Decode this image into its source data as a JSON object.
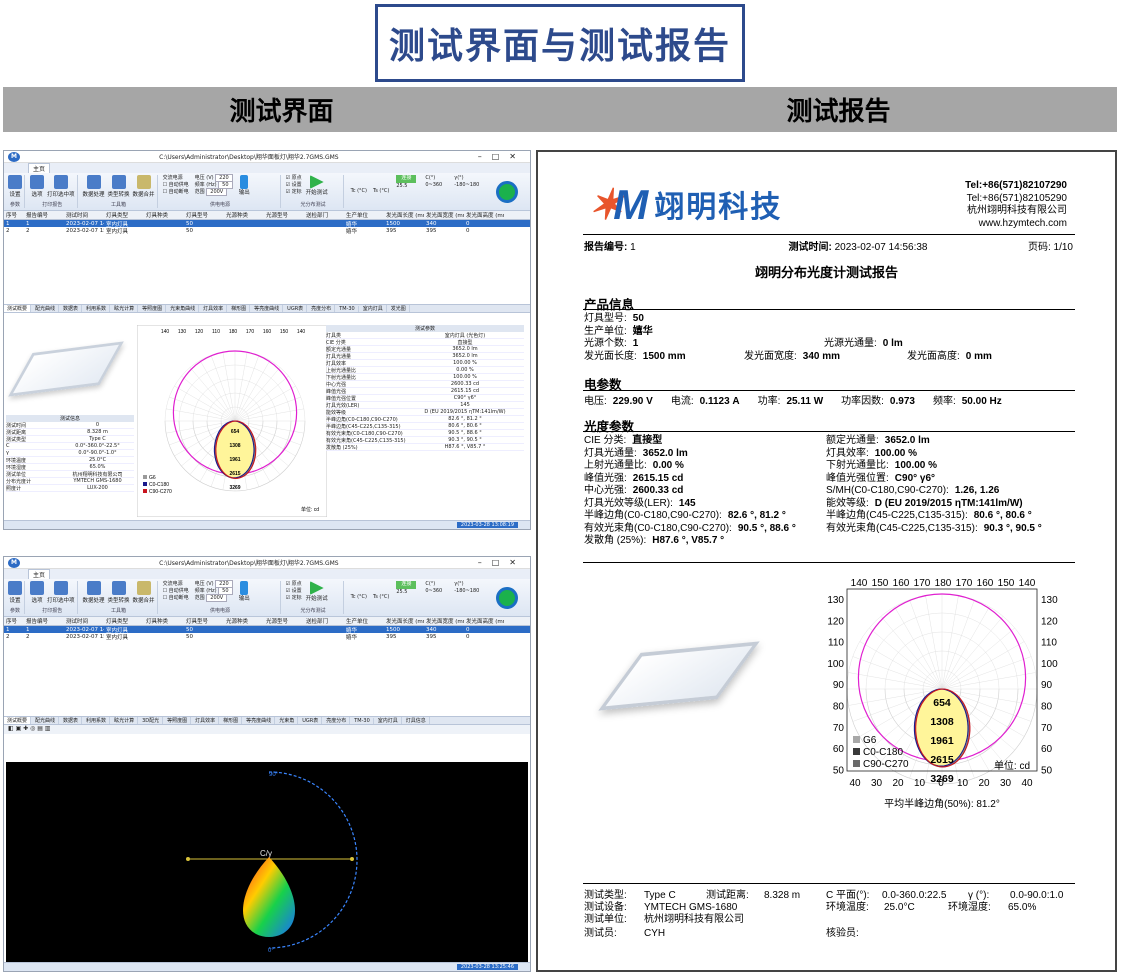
{
  "page": {
    "title": "测试界面与测试报告",
    "left_header": "测试界面",
    "right_header": "测试报告"
  },
  "software": {
    "window_path": "C:\\Users\\Administrator\\Desktop\\翔华面板灯\\翔华2.7GMS.GMS",
    "window_path_2": "C:\\Users\\Administrator\\Desktop\\翔华面板灯\\翔华2.7GMS.GMS",
    "menu_tab": "主页",
    "ribbon_groups": [
      "参数",
      "打印报告",
      "工具箱",
      "供电电源",
      "光分布测试"
    ],
    "ribbon_buttons": [
      "设置",
      "选项",
      "打印选中项",
      "数据处理",
      "类型转换",
      "数据合并"
    ],
    "power_options": [
      "交流电源",
      "自动供电",
      "自动断电"
    ],
    "voltage_label": "电压 (V)",
    "voltage_value": "220",
    "freq_label": "频率 (Hz)",
    "freq_value": "50",
    "range_label": "范围",
    "range_value": "200V",
    "output_label": "输出",
    "checks": [
      "原点",
      "设置",
      "定标"
    ],
    "start_test": "开始测试",
    "tc_label": "Tc (°C)",
    "ts_label": "Ts (°C)",
    "status_green": "连接",
    "c_label": "C(°)",
    "gamma_label": "γ(°)",
    "c_range": "0~360",
    "gamma_range": "-180~180",
    "temp_value": "25.5",
    "table_headers": [
      "序号",
      "报告编号",
      "测试时间",
      "灯具类型",
      "灯具种类",
      "灯具型号",
      "光源种类",
      "光源型号",
      "送检部门",
      "生产单位",
      "发光面长度 (mm)",
      "发光面宽度 (mm)",
      "发光面高度 (mm)"
    ],
    "table_rows": [
      [
        "1",
        "1",
        "2023-02-07 14:56:38",
        "室内灯具",
        "",
        "50",
        "",
        "",
        "",
        "嬉华",
        "1500",
        "340",
        "0"
      ],
      [
        "2",
        "2",
        "2023-02-07 15:10:30",
        "室内灯具",
        "",
        "50",
        "",
        "",
        "",
        "嬉华",
        "395",
        "395",
        "0"
      ]
    ],
    "lower_label": "测试结果",
    "result_tabs": [
      "测试概要",
      "配光曲线",
      "数据表",
      "利用系数",
      "眩光计算",
      "等照度图",
      "光束角曲线",
      "灯具效率",
      "梯形图",
      "等亮度曲线",
      "UGR表",
      "亮度分布",
      "TM-30",
      "室内灯具",
      "发光图"
    ],
    "test_info_title": "测试信息",
    "test_info": [
      [
        "测试时间",
        "0"
      ],
      [
        "测试距离",
        "8.328 m"
      ],
      [
        "测试类型",
        "Type C"
      ],
      [
        "C",
        "0.0°-360.0°-22.5°"
      ],
      [
        "γ",
        "0.0°-90.0°-1.0°"
      ],
      [
        "环境温度",
        "25.0°C"
      ],
      [
        "环境湿度",
        "65.0%"
      ],
      [
        "测试单位",
        "杭州翔明科技有限公司"
      ],
      [
        "分布光度计",
        "YMTECH GMS-1680"
      ],
      [
        "照度计",
        "LUX-200"
      ]
    ],
    "results_title": "测试参数",
    "results": [
      [
        "灯具类",
        "室内灯具 (光色灯)"
      ],
      [
        "CIE 分类",
        "直接型"
      ],
      [
        "额定光通量",
        "3652.0 lm"
      ],
      [
        "灯具光通量",
        "3652.0 lm"
      ],
      [
        "灯具效率",
        "100.00 %"
      ],
      [
        "上射光通量比",
        "0.00 %"
      ],
      [
        "下射光通量比",
        "100.00 %"
      ],
      [
        "中心光强",
        "2600.33 cd"
      ],
      [
        "峰值光强",
        "2615.15 cd"
      ],
      [
        "峰值光强位置",
        "C90° γ6°"
      ],
      [
        "灯具光效(LER)",
        "145"
      ],
      [
        "能效等级",
        "D (EU 2019/2015 ηTM:141lm/W)"
      ],
      [
        "半峰边角(C0-C180,C90-C270)",
        "82.6 °, 81.2 °"
      ],
      [
        "半峰边角(C45-C225,C135-315)",
        "80.6 °, 80.6 °"
      ],
      [
        "有效光束角(C0-C180,C90-C270)",
        "90.5 °, 88.6 °"
      ],
      [
        "有效光束角(C45-C225,C135-315)",
        "90.3 °, 90.5 °"
      ],
      [
        "发散角 (25%)",
        "H87.6 °, V85.7 °"
      ]
    ],
    "polar_angles_top": [
      "140",
      "130",
      "120",
      "110",
      "180",
      "170",
      "160",
      "150",
      "140"
    ],
    "polar_values": [
      "654",
      "1308",
      "1961",
      "2615",
      "3269"
    ],
    "polar_unit": "单位: cd",
    "polar_legend": [
      "G6",
      "C0-C180",
      "C90-C270"
    ],
    "status_time": "2023-03-28 13:08:19",
    "status_time_2": "2023-03-28 13:25:46",
    "bottom_toolbar_tabs": [
      "测试概要",
      "配光曲线",
      "数据表",
      "利用系数",
      "眩光计算",
      "3D配光",
      "等照度图",
      "灯具效率",
      "梯形图",
      "等亮度曲线",
      "光束角",
      "UGR表",
      "亮度分布",
      "TM-30",
      "室内灯具",
      "灯具信息"
    ],
    "scene_label_top": "90°",
    "scene_label_center": "C/γ",
    "scene_label_bottom": "0°"
  },
  "report": {
    "logo_text": "翊明科技",
    "tel1": "Tel:+86(571)82107290",
    "tel2": "Tel:+86(571)82105290",
    "company": "杭州翊明科技有限公司",
    "website": "www.hzymtech.com",
    "report_no_label": "报告编号:",
    "report_no": "1",
    "test_time_label": "测试时间:",
    "test_time": "2023-02-07 14:56:38",
    "page_label": "页码:",
    "page": "1/10",
    "title": "翊明分布光度计测试报告",
    "sec_product": "产品信息",
    "model_label": "灯具型号:",
    "model": "50",
    "maker_label": "生产单位:",
    "maker": "嬉华",
    "src_count_label": "光源个数:",
    "src_count": "1",
    "src_flux_label": "光源光通量:",
    "src_flux": "0 lm",
    "len_label": "发光面长度:",
    "len": "1500 mm",
    "wid_label": "发光面宽度:",
    "wid": "340 mm",
    "hei_label": "发光面高度:",
    "hei": "0 mm",
    "sec_elec": "电参数",
    "volt_label": "电压:",
    "volt": "229.90 V",
    "curr_label": "电流:",
    "curr": "0.1123 A",
    "power_label": "功率:",
    "power": "25.11 W",
    "pf_label": "功率因数:",
    "pf": "0.973",
    "freq_label": "频率:",
    "freq": "50.00 Hz",
    "sec_optical": "光度参数",
    "optical": [
      [
        [
          "CIE 分类:",
          "直接型"
        ],
        [
          "额定光通量:",
          "3652.0 lm"
        ]
      ],
      [
        [
          "灯具光通量:",
          "3652.0 lm"
        ],
        [
          "灯具效率:",
          "100.00 %"
        ]
      ],
      [
        [
          "上射光通量比:",
          "0.00 %"
        ],
        [
          "下射光通量比:",
          "100.00 %"
        ]
      ],
      [
        [
          "峰值光强:",
          "2615.15 cd"
        ],
        [
          "峰值光强位置:",
          "C90° γ6°"
        ]
      ],
      [
        [
          "中心光强:",
          "2600.33 cd"
        ],
        [
          "S/MH(C0-C180,C90-C270):",
          "1.26, 1.26"
        ]
      ],
      [
        [
          "灯具光效等级(LER):",
          "145"
        ],
        [
          "能效等级:",
          "D (EU 2019/2015 ηTM:141lm/W)"
        ]
      ],
      [
        [
          "半峰边角(C0-C180,C90-C270):",
          "82.6 °, 81.2 °"
        ],
        [
          "半峰边角(C45-C225,C135-315):",
          "80.6 °, 80.6 °"
        ]
      ],
      [
        [
          "有效光束角(C0-C180,C90-C270):",
          "90.5 °, 88.6 °"
        ],
        [
          "有效光束角(C45-C225,C135-315):",
          "90.3 °, 90.5 °"
        ]
      ],
      [
        [
          "发散角 (25%):",
          "H87.6 °, V85.7 °"
        ],
        [
          "",
          ""
        ]
      ]
    ],
    "polar_top": [
      "140",
      "150",
      "160",
      "170",
      "180",
      "170",
      "160",
      "150",
      "140"
    ],
    "polar_left": [
      "130",
      "120",
      "110",
      "100",
      "90",
      "80",
      "70",
      "60",
      "50"
    ],
    "polar_right": [
      "130",
      "120",
      "110",
      "100",
      "90",
      "80",
      "70",
      "60",
      "50"
    ],
    "polar_bottom": [
      "40",
      "30",
      "20",
      "10",
      "0",
      "10",
      "20",
      "30",
      "40"
    ],
    "polar_rings": [
      "654",
      "1308",
      "1961",
      "2615",
      "3269"
    ],
    "polar_unit": "单位: cd",
    "legend": [
      "G6",
      "C0-C180",
      "C90-C270"
    ],
    "half_angle": "平均半峰边角(50%): 81.2°",
    "foot": {
      "type_label": "测试类型:",
      "type": "Type C",
      "dist_label": "测试距离:",
      "dist": "8.328 m",
      "cplane_label": "C 平面(°):",
      "cplane": "0.0-360.0:22.5",
      "gamma_label": "γ (°):",
      "gamma": "0.0-90.0:1.0",
      "device_label": "测试设备:",
      "device": "YMTECH GMS-1680",
      "temp_label": "环境温度:",
      "temp": "25.0°C",
      "hum_label": "环境湿度:",
      "hum": "65.0%",
      "unit_label": "测试单位:",
      "unit": "杭州翊明科技有限公司",
      "tester_label": "测试员:",
      "tester": "CYH",
      "checker_label": "核验员:",
      "checker": ""
    }
  },
  "colors": {
    "accent": "#2d4a8c",
    "header_bar": "#a6a6a6",
    "envelope": "#e020d0",
    "fill": "#fff59a",
    "c0": "#1a1a8c",
    "c90": "#c8141e"
  }
}
